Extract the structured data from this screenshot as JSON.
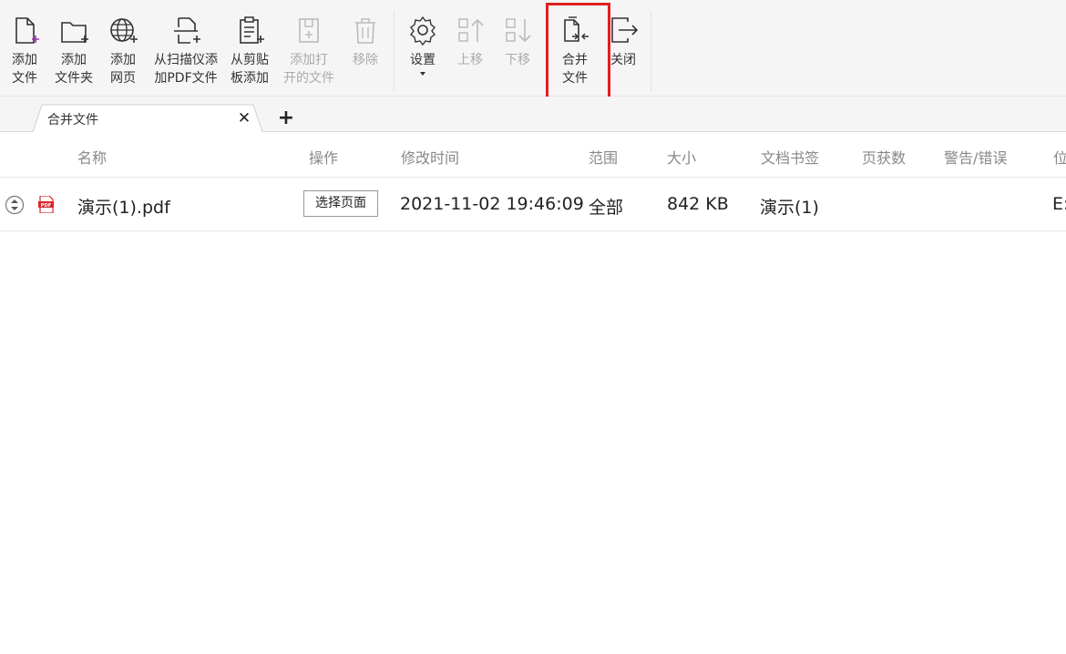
{
  "toolbar": {
    "buttons": [
      {
        "label": "添加\n文件",
        "icon": "add-file-icon",
        "disabled": false
      },
      {
        "label": "添加\n文件夹",
        "icon": "add-folder-icon",
        "disabled": false
      },
      {
        "label": "添加\n网页",
        "icon": "add-webpage-icon",
        "disabled": false
      },
      {
        "label": "从扫描仪添\n加PDF文件",
        "icon": "scanner-icon",
        "disabled": false
      },
      {
        "label": "从剪贴\n板添加",
        "icon": "clipboard-icon",
        "disabled": false
      },
      {
        "label": "添加打\n开的文件",
        "icon": "add-open-file-icon",
        "disabled": true
      },
      {
        "label": "移除",
        "icon": "trash-icon",
        "disabled": true
      },
      {
        "label": "设置",
        "icon": "gear-icon",
        "disabled": false
      },
      {
        "label": "上移",
        "icon": "move-up-icon",
        "disabled": true
      },
      {
        "label": "下移",
        "icon": "move-down-icon",
        "disabled": true
      },
      {
        "label": "合并\n文件",
        "icon": "merge-files-icon",
        "disabled": false
      },
      {
        "label": "关闭",
        "icon": "exit-icon",
        "disabled": false
      }
    ]
  },
  "tabs": [
    {
      "label": "合并文件",
      "close": "✕"
    }
  ],
  "add_tab": "+",
  "table": {
    "columns": [
      "名称",
      "操作",
      "修改时间",
      "范围",
      "大小",
      "文档书签",
      "页获数",
      "警告/错误",
      "位"
    ],
    "rows": [
      {
        "name": "演示(1).pdf",
        "action": "选择页面",
        "modified": "2021-11-02 19:46:09",
        "range": "全部",
        "size": "842 KB",
        "bookmark": "演示(1)",
        "pages": "",
        "warning": "",
        "location": "E:"
      }
    ]
  },
  "colors": {
    "highlight": "#e02020",
    "pdf_red": "#d9262b"
  }
}
